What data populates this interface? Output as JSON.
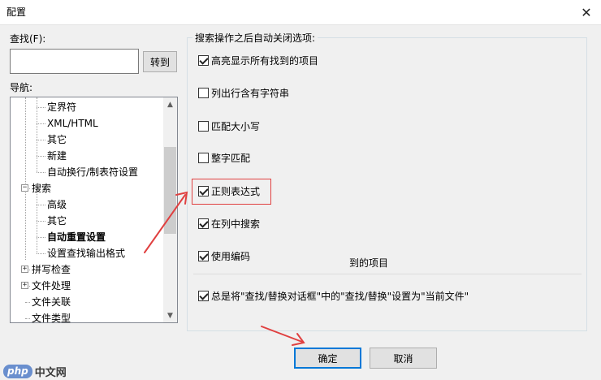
{
  "window": {
    "title": "配置",
    "close_glyph": "✕"
  },
  "find": {
    "label": "查找(F):",
    "value": "",
    "goto_label": "转到"
  },
  "nav": {
    "label": "导航:",
    "items": [
      {
        "label": "定界符",
        "level": 2,
        "bold": false
      },
      {
        "label": "XML/HTML",
        "level": 2,
        "bold": false
      },
      {
        "label": "其它",
        "level": 2,
        "bold": false
      },
      {
        "label": "新建",
        "level": 2,
        "bold": false
      },
      {
        "label": "自动换行/制表符设置",
        "level": 2,
        "bold": false
      },
      {
        "label": "搜索",
        "level": 1,
        "bold": false,
        "expander": "−"
      },
      {
        "label": "高级",
        "level": 2,
        "bold": false
      },
      {
        "label": "其它",
        "level": 2,
        "bold": false
      },
      {
        "label": "自动重置设置",
        "level": 2,
        "bold": true
      },
      {
        "label": "设置查找输出格式",
        "level": 2,
        "bold": false
      },
      {
        "label": "拼写检查",
        "level": 1,
        "bold": false,
        "expander": "+"
      },
      {
        "label": "文件处理",
        "level": 1,
        "bold": false,
        "expander": "+"
      },
      {
        "label": "文件关联",
        "level": 1,
        "bold": false
      },
      {
        "label": "文件类型",
        "level": 1,
        "bold": false
      }
    ],
    "scroll_up_glyph": "▲",
    "scroll_down_glyph": "▼"
  },
  "group": {
    "title": "搜索操作之后自动关闭选项:",
    "options": [
      {
        "label": "高亮显示所有找到的项目",
        "checked": true
      },
      {
        "label": "列出行含有字符串",
        "checked": false
      },
      {
        "label": "匹配大小写",
        "checked": false
      },
      {
        "label": "整字匹配",
        "checked": false
      },
      {
        "label": "正则表达式",
        "checked": true
      },
      {
        "label": "在列中搜索",
        "checked": true
      },
      {
        "label": "使用编码",
        "checked": true
      }
    ],
    "overlay_text": "到的项目",
    "global_option": {
      "label": "总是将\"查找/替换对话框\"中的\"查找/替换\"设置为\"当前文件\"",
      "checked": true
    }
  },
  "buttons": {
    "ok": "确定",
    "cancel": "取消"
  },
  "watermark": {
    "badge": "php",
    "text": "中文网"
  },
  "colors": {
    "annotation": "#e04040",
    "accent": "#0078d7",
    "watermark_badge": "#6a8fce"
  }
}
